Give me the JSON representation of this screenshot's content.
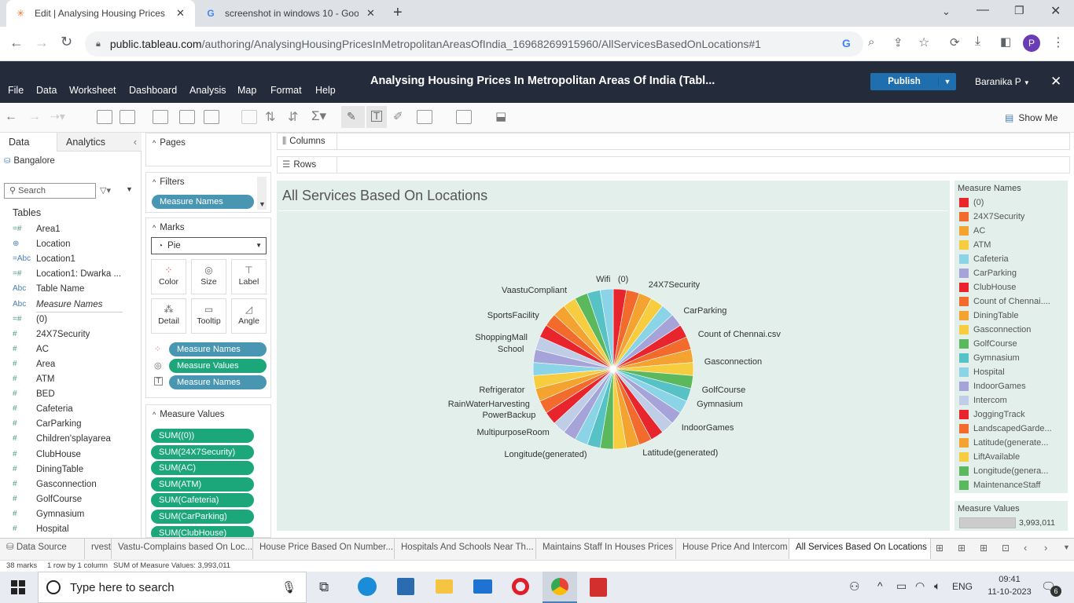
{
  "browser": {
    "tabs": [
      {
        "title": "Edit | Analysing Housing Prices I",
        "active": true
      },
      {
        "title": "screenshot in windows 10 - Goo",
        "active": false
      }
    ],
    "url_host": "public.tableau.com",
    "url_path": "/authoring/AnalysingHousingPricesInMetropolitanAreasOfIndia_16968269915960/AllServicesBasedOnLocations#1",
    "profile_initial": "P"
  },
  "tableau": {
    "menus": [
      "File",
      "Data",
      "Worksheet",
      "Dashboard",
      "Analysis",
      "Map",
      "Format",
      "Help"
    ],
    "workbook_title": "Analysing Housing Prices In Metropolitan Areas Of India (Tabl...",
    "publish_label": "Publish",
    "user": "Baranika P",
    "show_me": "Show Me"
  },
  "data_pane": {
    "tab_data": "Data",
    "tab_analytics": "Analytics",
    "datasource": "Bangalore",
    "search_placeholder": "Search",
    "tables_label": "Tables",
    "fields": [
      {
        "icon": "=#",
        "name": "Area1",
        "italic": false
      },
      {
        "icon": "globe",
        "name": "Location",
        "italic": false
      },
      {
        "icon": "=Abc",
        "name": "Location1",
        "italic": false
      },
      {
        "icon": "=#",
        "name": "Location1: Dwarka ...",
        "italic": false
      },
      {
        "icon": "Abc",
        "name": "Table Name",
        "italic": false
      },
      {
        "icon": "Abc",
        "name": "Measure Names",
        "italic": true
      },
      {
        "icon": "=#",
        "name": "(0)",
        "italic": false
      },
      {
        "icon": "#",
        "name": "24X7Security",
        "italic": false
      },
      {
        "icon": "#",
        "name": "AC",
        "italic": false
      },
      {
        "icon": "#",
        "name": "Area",
        "italic": false
      },
      {
        "icon": "#",
        "name": "ATM",
        "italic": false
      },
      {
        "icon": "#",
        "name": "BED",
        "italic": false
      },
      {
        "icon": "#",
        "name": "Cafeteria",
        "italic": false
      },
      {
        "icon": "#",
        "name": "CarParking",
        "italic": false
      },
      {
        "icon": "#",
        "name": "Children'splayarea",
        "italic": false
      },
      {
        "icon": "#",
        "name": "ClubHouse",
        "italic": false
      },
      {
        "icon": "#",
        "name": "DiningTable",
        "italic": false
      },
      {
        "icon": "#",
        "name": "Gasconnection",
        "italic": false
      },
      {
        "icon": "#",
        "name": "GolfCourse",
        "italic": false
      },
      {
        "icon": "#",
        "name": "Gymnasium",
        "italic": false
      },
      {
        "icon": "#",
        "name": "Hospital",
        "italic": false
      }
    ]
  },
  "shelves": {
    "pages": "Pages",
    "filters": "Filters",
    "filter_pill": "Measure Names",
    "marks": "Marks",
    "mark_type": "Pie",
    "mark_buttons": [
      "Color",
      "Size",
      "Label",
      "Detail",
      "Tooltip",
      "Angle"
    ],
    "mark_pills": [
      {
        "label": "Measure Names",
        "kind": "blue"
      },
      {
        "label": "Measure Values",
        "kind": "green"
      },
      {
        "label": "Measure Names",
        "kind": "blue"
      }
    ],
    "measure_values": "Measure Values",
    "measure_pills": [
      "SUM((0))",
      "SUM(24X7Security)",
      "SUM(AC)",
      "SUM(ATM)",
      "SUM(Cafeteria)",
      "SUM(CarParking)",
      "SUM(ClubHouse)"
    ],
    "columns": "Columns",
    "rows": "Rows"
  },
  "view": {
    "title": "All Services Based On Locations"
  },
  "chart_data": {
    "type": "pie",
    "title": "All Services Based On Locations",
    "slices_count": 38,
    "slice_colors": [
      "#e8252d",
      "#f26b2d",
      "#f4a230",
      "#f7cc3f",
      "#8bd3e6",
      "#a6a3d8",
      "#e8252d",
      "#f26b2d",
      "#f4a230",
      "#f7cc3f",
      "#5cb85c",
      "#56c2c6",
      "#8bd3e6",
      "#a6a3d8",
      "#bfcde6",
      "#e8252d",
      "#f26b2d",
      "#f4a230",
      "#f7cc3f",
      "#5cb85c",
      "#56c2c6",
      "#8bd3e6",
      "#a6a3d8",
      "#bfcde6",
      "#e8252d",
      "#f26b2d",
      "#f4a230",
      "#f7cc3f",
      "#8bd3e6",
      "#a6a3d8",
      "#bfcde6",
      "#e8252d",
      "#f26b2d",
      "#f4a230",
      "#f7cc3f",
      "#5cb85c",
      "#56c2c6",
      "#8bd3e6"
    ],
    "slice_labels": [
      {
        "text": "(0)",
        "angle": 8
      },
      {
        "text": "24X7Security",
        "angle": 22
      },
      {
        "text": "CarParking",
        "angle": 50
      },
      {
        "text": "Count of Chennai.csv",
        "angle": 68
      },
      {
        "text": "Gasconnection",
        "angle": 86
      },
      {
        "text": "GolfCourse",
        "angle": 104
      },
      {
        "text": "Gymnasium",
        "angle": 114
      },
      {
        "text": "IndoorGames",
        "angle": 132
      },
      {
        "text": "Latitude(generated)",
        "angle": 162
      },
      {
        "text": "Longitude(generated)",
        "angle": 196
      },
      {
        "text": "MultipurposeRoom",
        "angle": 224
      },
      {
        "text": "PowerBackup",
        "angle": 238
      },
      {
        "text": "RainWaterHarvesting",
        "angle": 246
      },
      {
        "text": "Refrigerator",
        "angle": 256
      },
      {
        "text": "School",
        "angle": 282
      },
      {
        "text": "ShoppingMall",
        "angle": 290
      },
      {
        "text": "SportsFacility",
        "angle": 306
      },
      {
        "text": "VaastuCompliant",
        "angle": 330
      },
      {
        "text": "Wifi",
        "angle": 354
      }
    ]
  },
  "legend": {
    "title": "Measure Names",
    "items": [
      {
        "label": "(0)",
        "color": "#e8252d"
      },
      {
        "label": "24X7Security",
        "color": "#f26b2d"
      },
      {
        "label": "AC",
        "color": "#f4a230"
      },
      {
        "label": "ATM",
        "color": "#f7cc3f"
      },
      {
        "label": "Cafeteria",
        "color": "#8bd3e6"
      },
      {
        "label": "CarParking",
        "color": "#a6a3d8"
      },
      {
        "label": "ClubHouse",
        "color": "#e8252d"
      },
      {
        "label": "Count of Chennai....",
        "color": "#f26b2d"
      },
      {
        "label": "DiningTable",
        "color": "#f4a230"
      },
      {
        "label": "Gasconnection",
        "color": "#f7cc3f"
      },
      {
        "label": "GolfCourse",
        "color": "#5cb85c"
      },
      {
        "label": "Gymnasium",
        "color": "#56c2c6"
      },
      {
        "label": "Hospital",
        "color": "#8bd3e6"
      },
      {
        "label": "IndoorGames",
        "color": "#a6a3d8"
      },
      {
        "label": "Intercom",
        "color": "#bfcde6"
      },
      {
        "label": "JoggingTrack",
        "color": "#e8252d"
      },
      {
        "label": "LandscapedGarde...",
        "color": "#f26b2d"
      },
      {
        "label": "Latitude(generate...",
        "color": "#f4a230"
      },
      {
        "label": "LiftAvailable",
        "color": "#f7cc3f"
      },
      {
        "label": "Longitude(genera...",
        "color": "#5cb85c"
      },
      {
        "label": "MaintenanceStaff",
        "color": "#5cb85c"
      }
    ],
    "size_title": "Measure Values",
    "size_value": "3,993,011"
  },
  "sheet_tabs": [
    {
      "label": "Data Source",
      "active": false
    },
    {
      "label": "rvest",
      "active": false
    },
    {
      "label": "Vastu-Complains based On Loc...",
      "active": false
    },
    {
      "label": "House Price Based On Number...",
      "active": false
    },
    {
      "label": "Hospitals And Schools Near Th...",
      "active": false
    },
    {
      "label": "Maintains Staff In Houses Prices",
      "active": false
    },
    {
      "label": "House Price And Intercom",
      "active": false
    },
    {
      "label": "All Services Based On Locations",
      "active": true
    }
  ],
  "status": {
    "marks": "38 marks",
    "rows": "1 row by 1 column",
    "sum": "SUM of Measure Values: 3,993,011"
  },
  "taskbar": {
    "search_placeholder": "Type here to search",
    "lang": "ENG",
    "time": "09:41",
    "date": "11-10-2023",
    "notif_count": "6"
  }
}
